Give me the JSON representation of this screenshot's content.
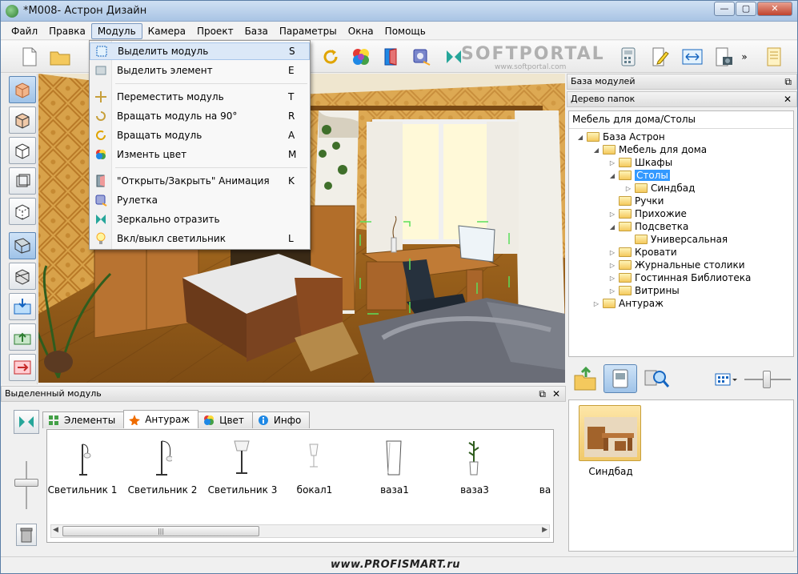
{
  "window": {
    "title": "*M008- Астрон Дизайн"
  },
  "menubar": [
    "Файл",
    "Правка",
    "Модуль",
    "Камера",
    "Проект",
    "База",
    "Параметры",
    "Окна",
    "Помощь"
  ],
  "module_menu": [
    {
      "label": "Выделить модуль",
      "shortcut": "S",
      "icon": "select-module-icon"
    },
    {
      "label": "Выделить элемент",
      "shortcut": "E",
      "icon": "select-element-icon"
    },
    {
      "label": "Переместить модуль",
      "shortcut": "T",
      "icon": "move-icon"
    },
    {
      "label": "Вращать модуль на 90°",
      "shortcut": "R",
      "icon": "rotate-90-icon"
    },
    {
      "label": "Вращать модуль",
      "shortcut": "A",
      "icon": "rotate-icon"
    },
    {
      "label": "Изменть цвет",
      "shortcut": "M",
      "icon": "color-icon"
    },
    {
      "label": "\"Открыть/Закрыть\" Анимация",
      "shortcut": "K",
      "icon": "door-animation-icon"
    },
    {
      "label": "Рулетка",
      "shortcut": "",
      "icon": "tape-measure-icon"
    },
    {
      "label": "Зеркально отразить",
      "shortcut": "",
      "icon": "mirror-icon"
    },
    {
      "label": "Вкл/выкл светильник",
      "shortcut": "L",
      "icon": "lamp-toggle-icon"
    }
  ],
  "watermark": {
    "main": "SOFTPORTAL",
    "sub": "www.softportal.com"
  },
  "module_base_panel": {
    "title": "База модулей"
  },
  "folder_tree_panel": {
    "title": "Дерево папок",
    "path": "Мебель для дома/Столы",
    "items": [
      {
        "label": "База Астрон",
        "level": 0,
        "toggle": "◢"
      },
      {
        "label": "Мебель для дома",
        "level": 1,
        "toggle": "◢"
      },
      {
        "label": "Шкафы",
        "level": 2,
        "toggle": "▷"
      },
      {
        "label": "Столы",
        "level": 2,
        "toggle": "◢",
        "selected": true
      },
      {
        "label": "Синдбад",
        "level": 3,
        "toggle": "▷"
      },
      {
        "label": "Ручки",
        "level": 2,
        "toggle": ""
      },
      {
        "label": "Прихожие",
        "level": 2,
        "toggle": "▷"
      },
      {
        "label": "Подсветка",
        "level": 2,
        "toggle": "◢"
      },
      {
        "label": "Универсальная",
        "level": 3,
        "toggle": ""
      },
      {
        "label": "Кровати",
        "level": 2,
        "toggle": "▷"
      },
      {
        "label": "Журнальные столики",
        "level": 2,
        "toggle": "▷"
      },
      {
        "label": "Гостинная Библиотека",
        "level": 2,
        "toggle": "▷"
      },
      {
        "label": "Витрины",
        "level": 2,
        "toggle": "▷"
      },
      {
        "label": "Антураж",
        "level": 1,
        "toggle": "▷"
      }
    ]
  },
  "library": {
    "items": [
      {
        "label": "Синдбад"
      }
    ]
  },
  "selected_module_panel": {
    "title": "Выделенный модуль",
    "tabs": [
      {
        "label": "Элементы",
        "icon": "elements-icon"
      },
      {
        "label": "Антураж",
        "icon": "decor-icon",
        "active": true
      },
      {
        "label": "Цвет",
        "icon": "color-icon"
      },
      {
        "label": "Инфо",
        "icon": "info-icon"
      }
    ],
    "objects": [
      "Светильник 1",
      "Светильник 2",
      "Светильник 3",
      "бокал1",
      "ваза1",
      "ваза3",
      "ва"
    ]
  },
  "footer": {
    "source": "www.PROFISMART.ru"
  },
  "colors": {
    "selection": "#3399ff",
    "menu_highlight": "#dbe8f7",
    "titlebar": "#b9d1ea"
  }
}
